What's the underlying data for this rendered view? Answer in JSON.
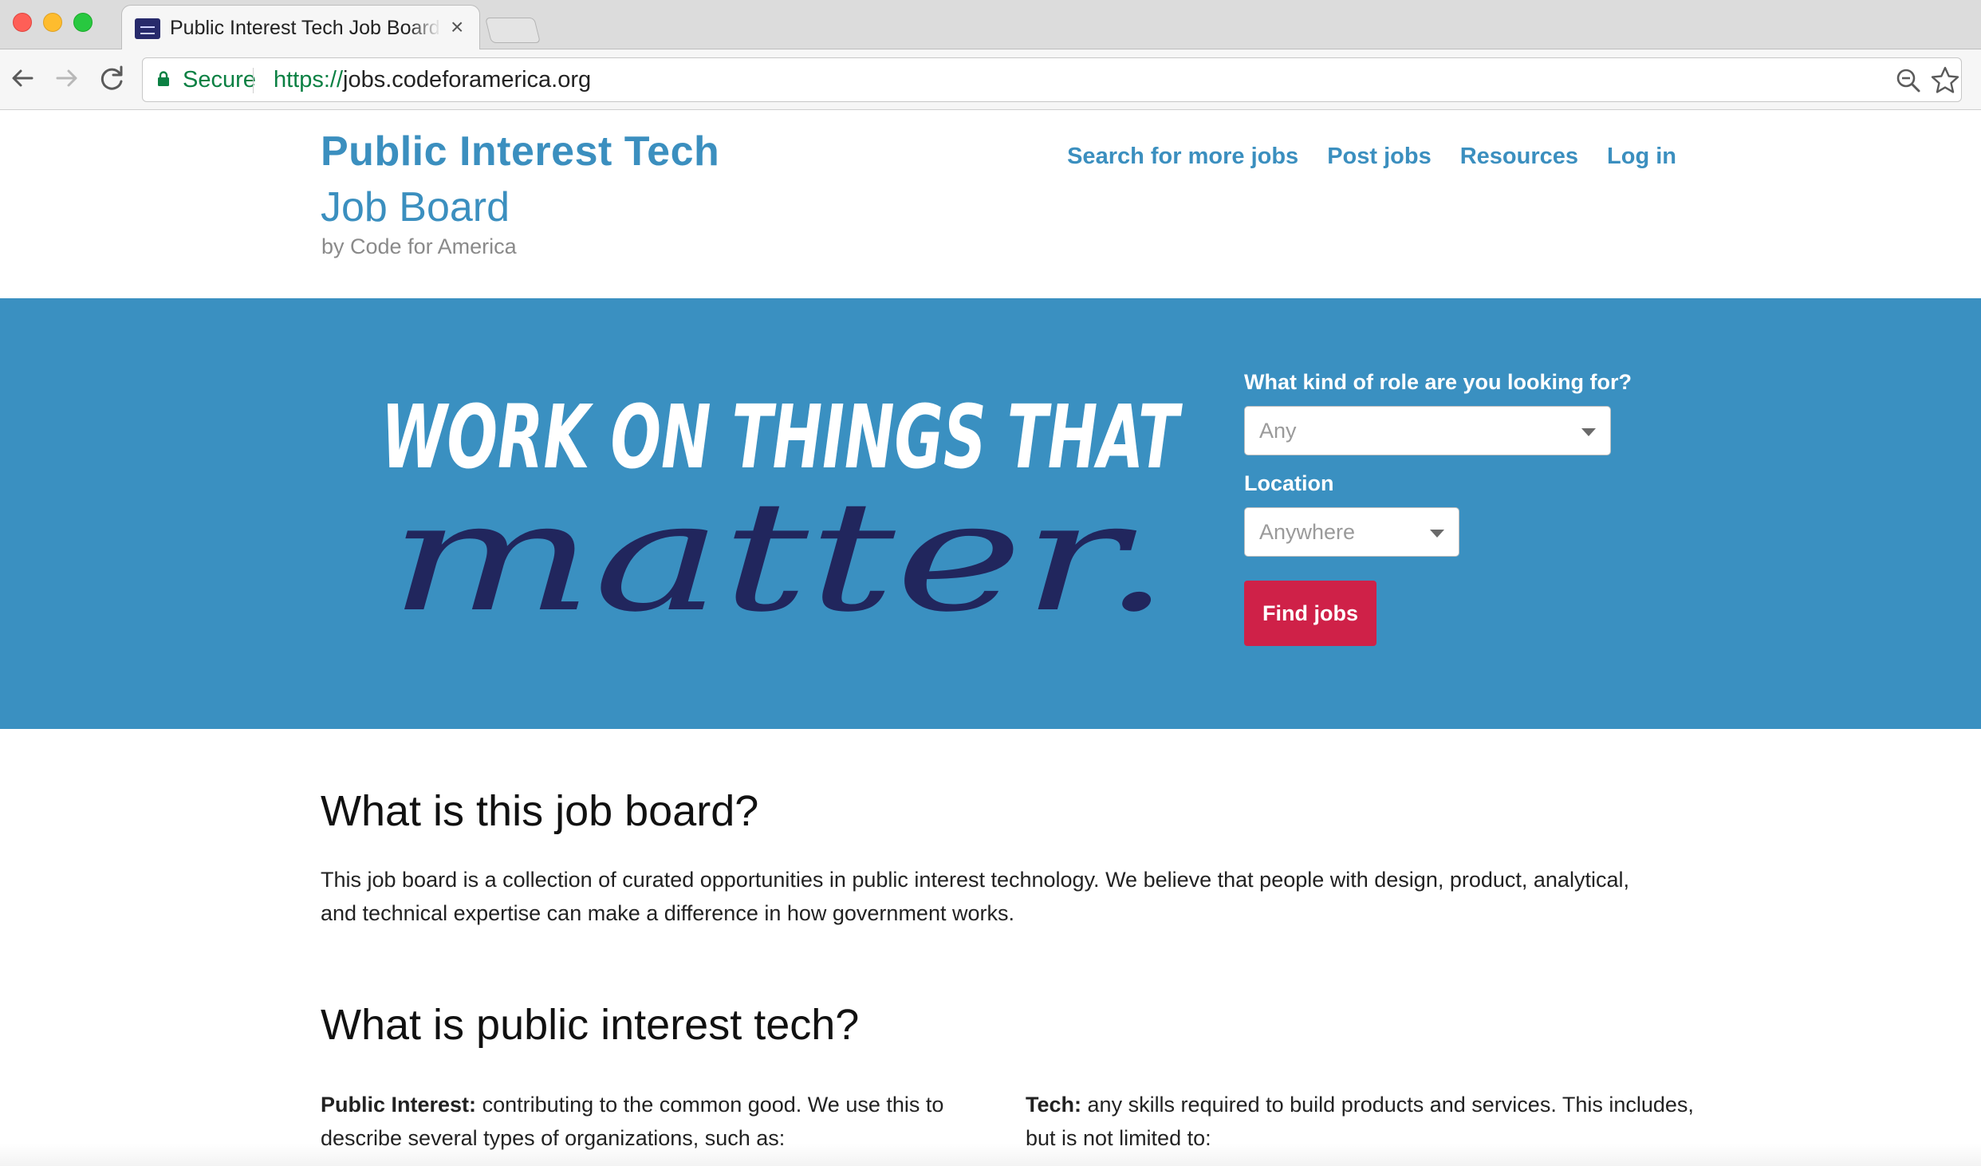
{
  "browser": {
    "tab_title": "Public Interest Tech Job Board",
    "tab_close": "×",
    "secure_label": "Secure",
    "url_scheme": "https://",
    "url_host": "jobs.codeforamerica.org",
    "icons": [
      "back-arrow-icon",
      "forward-arrow-icon",
      "reload-icon",
      "lock-icon",
      "zoom-icon",
      "star-icon"
    ]
  },
  "header": {
    "brand_line1": "Public Interest Tech",
    "brand_line2": "Job Board",
    "brand_by": "by Code for America",
    "nav": [
      "Search for more jobs",
      "Post jobs",
      "Resources",
      "Log in"
    ]
  },
  "hero": {
    "tagline_top": "WORK ON THINGS THAT",
    "tagline_script": "matter.",
    "role_label": "What kind of role are you looking for?",
    "role_value": "Any",
    "location_label": "Location",
    "location_value": "Anywhere",
    "submit_label": "Find jobs",
    "colors": {
      "background": "#3a90c1",
      "script": "#21265d",
      "button": "#cf2148"
    }
  },
  "content": {
    "h1": "What is this job board?",
    "p1": "This job board is a collection of curated opportunities in public interest technology. We believe that people with design, product, analytical, and technical expertise can make a difference in how government works.",
    "h2": "What is public interest tech?",
    "left_term": "Public Interest:",
    "left_text": "contributing to the common good. We use this to describe several types of organizations, such as:",
    "right_term": "Tech:",
    "right_text": "any skills required to build products and services. This includes, but is not limited to:"
  },
  "colors": {
    "brand": "#3b8fbf"
  }
}
